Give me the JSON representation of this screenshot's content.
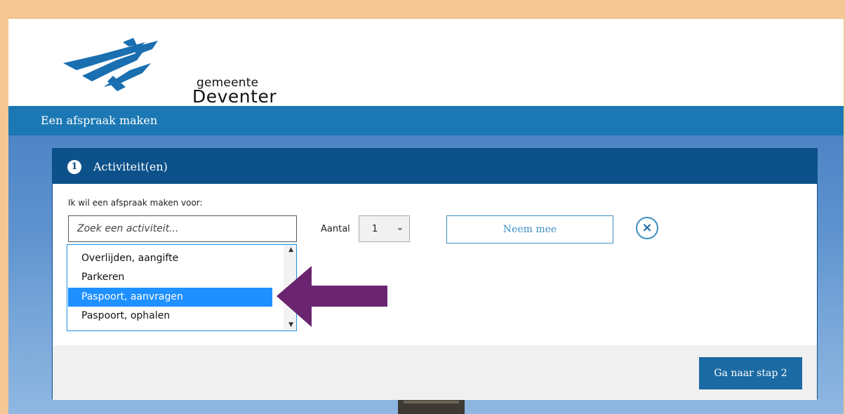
{
  "logo": {
    "line1": "gemeente",
    "line2": "Deventer"
  },
  "titlebar": {
    "title": "Een afspraak maken"
  },
  "panel": {
    "step_number": "1",
    "title": "Activiteit(en)",
    "intro": "Ik wil een afspraak maken voor:",
    "search_placeholder": "Zoek een activiteit...",
    "aantal_label": "Aantal",
    "aantal_value": "1",
    "neem_mee": "Neem mee",
    "next_button": "Ga naar stap 2"
  },
  "dropdown": {
    "items": [
      {
        "label": "Overlijden, aangifte"
      },
      {
        "label": "Parkeren"
      },
      {
        "label": "Paspoort, aanvragen"
      },
      {
        "label": "Paspoort, ophalen"
      }
    ],
    "selected_index": 2
  },
  "colors": {
    "frame": "#f4c795",
    "titlebar": "#1b78b4",
    "panel_header": "#0c5189",
    "selection": "#1e90ff",
    "arrow": "#6b2470"
  }
}
